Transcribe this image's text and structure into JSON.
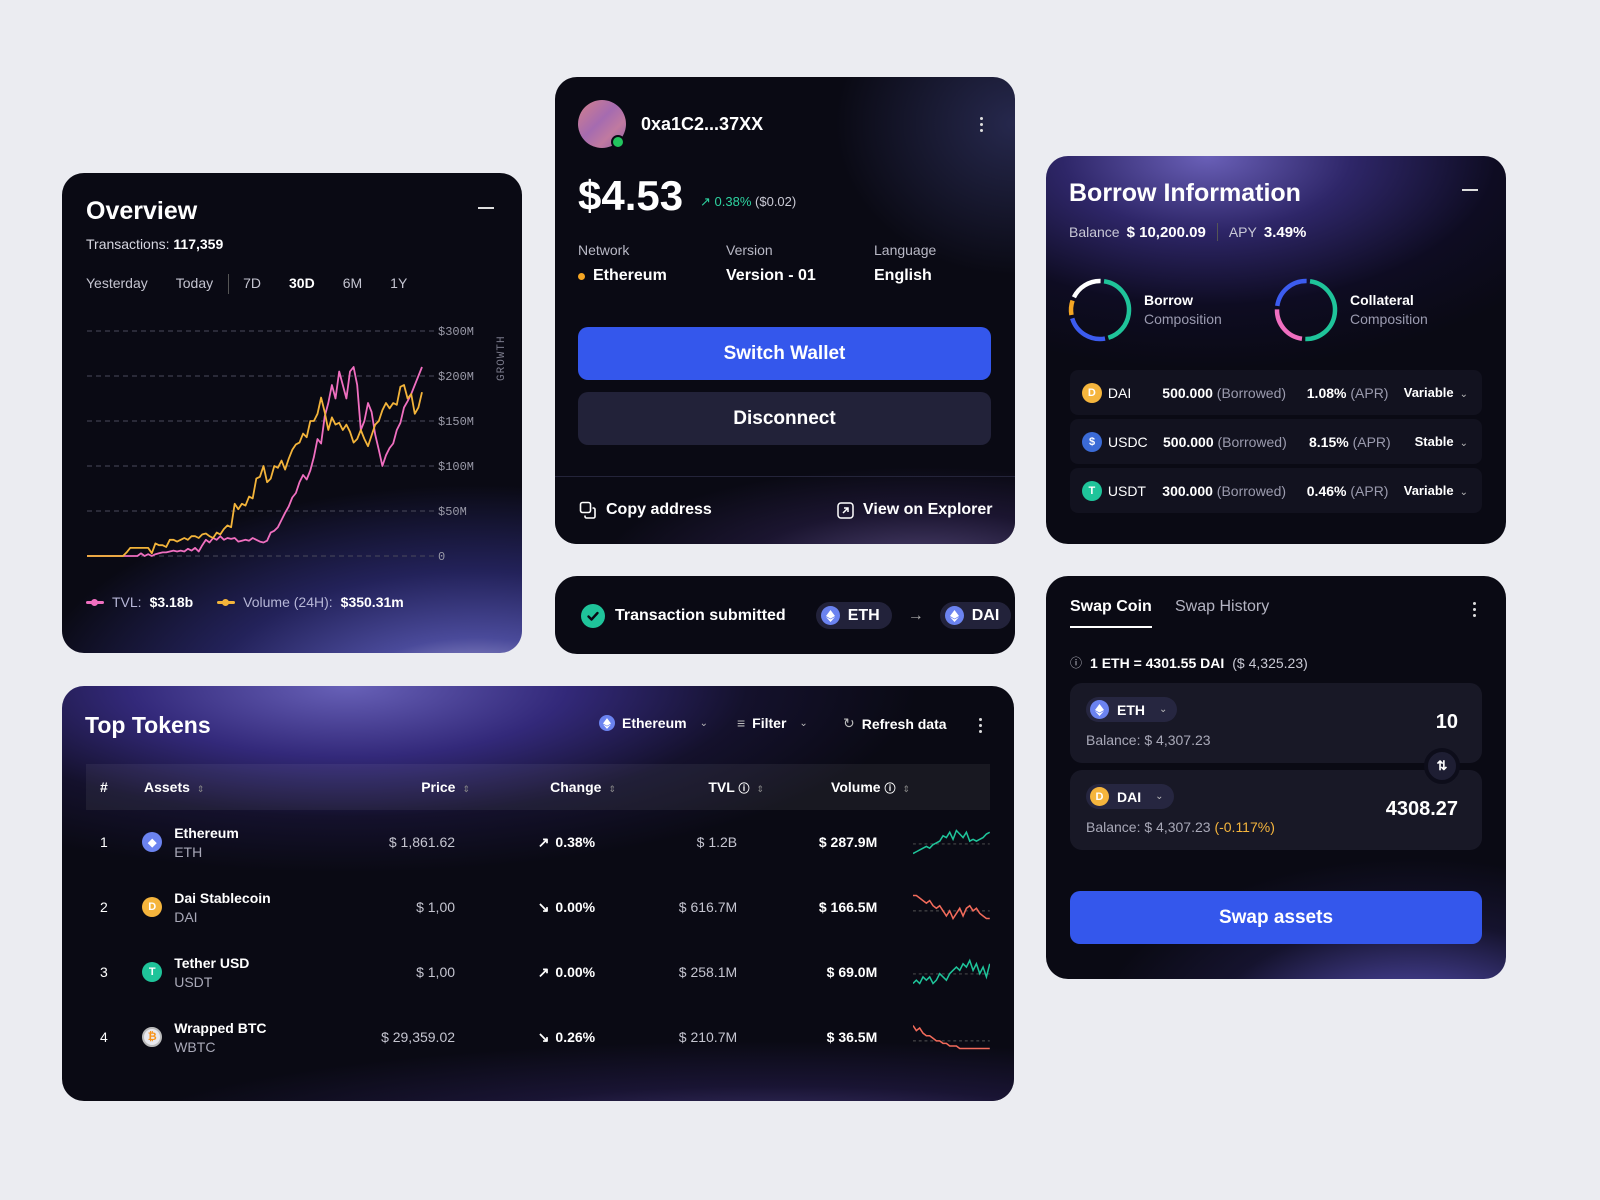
{
  "overview": {
    "title": "Overview",
    "transactions_label": "Transactions:",
    "transactions_value": "117,359",
    "ranges": [
      "Yesterday",
      "Today",
      "7D",
      "30D",
      "6M",
      "1Y"
    ],
    "active_range": "30D",
    "legend": [
      {
        "label": "TVL:",
        "value": "$3.18b",
        "color": "#f06fc0"
      },
      {
        "label": "Volume (24H):",
        "value": "$350.31m",
        "color": "#f3b43a"
      }
    ]
  },
  "chart_data": {
    "type": "line",
    "title": "",
    "xlabel": "",
    "ylabel": "GROWTH",
    "ylim": [
      0,
      300
    ],
    "y_ticks": [
      "0",
      "$50M",
      "$100M",
      "$150M",
      "$200M",
      "$300M"
    ],
    "y_tick_values": [
      0,
      50,
      100,
      150,
      200,
      250
    ],
    "grid": true,
    "legend_position": "bottom-left",
    "series": [
      {
        "name": "TVL",
        "color": "#f06fc0",
        "values": [
          0,
          0,
          0,
          0,
          0,
          0,
          0,
          0,
          0,
          0,
          0,
          0,
          0,
          0,
          0,
          3,
          0,
          2,
          0,
          2,
          3,
          4,
          4,
          5,
          6,
          5,
          6,
          5,
          8,
          6,
          9,
          5,
          12,
          18,
          15,
          20,
          18,
          22,
          18,
          20,
          19,
          20,
          16,
          17,
          18,
          17,
          20,
          18,
          16,
          15,
          17,
          26,
          28,
          32,
          40,
          48,
          55,
          65,
          70,
          82,
          90,
          85,
          95,
          110,
          130,
          125,
          155,
          170,
          190,
          175,
          205,
          190,
          175,
          205,
          210,
          190,
          140,
          150,
          170,
          160,
          135,
          118,
          100,
          112,
          120,
          125,
          140,
          148,
          165,
          172,
          180,
          190,
          200,
          210
        ]
      },
      {
        "name": "Volume (24H)",
        "color": "#f3b43a",
        "values": [
          0,
          0,
          0,
          0,
          0,
          0,
          0,
          0,
          0,
          0,
          0,
          4,
          9,
          9,
          9,
          9,
          9,
          9,
          3,
          14,
          12,
          12,
          10,
          18,
          18,
          16,
          18,
          20,
          18,
          22,
          22,
          20,
          24,
          25,
          22,
          20,
          26,
          24,
          30,
          34,
          32,
          58,
          52,
          58,
          56,
          66,
          64,
          86,
          88,
          100,
          82,
          86,
          100,
          98,
          106,
          96,
          108,
          118,
          124,
          126,
          136,
          132,
          150,
          150,
          158,
          176,
          160,
          140,
          154,
          146,
          148,
          140,
          146,
          138,
          126,
          130,
          140,
          130,
          122,
          134,
          146,
          150,
          162,
          170,
          164,
          170,
          168,
          188,
          190,
          175,
          180,
          158,
          165,
          182
        ]
      }
    ]
  },
  "wallet": {
    "address": "0xa1C2...37XX",
    "balance": "$4.53",
    "change_pct": "0.38%",
    "change_usd": "($0.02)",
    "network_label": "Network",
    "network_value": "Ethereum",
    "version_label": "Version",
    "version_value": "Version - 01",
    "language_label": "Language",
    "language_value": "English",
    "switch_label": "Switch Wallet",
    "disconnect_label": "Disconnect",
    "copy_label": "Copy address",
    "explorer_label": "View on Explorer"
  },
  "transaction": {
    "status": "Transaction submitted",
    "from": "ETH",
    "to": "DAI"
  },
  "borrow": {
    "title": "Borrow Information",
    "balance_label": "Balance",
    "balance_value": "$ 10,200.09",
    "apy_label": "APY",
    "apy_value": "3.49%",
    "borrow_comp": {
      "title": "Borrow",
      "sub": "Composition",
      "segments": [
        {
          "color": "#1fc49a",
          "share": 0.45
        },
        {
          "color": "#3c5cf0",
          "share": 0.25
        },
        {
          "color": "#f5a623",
          "share": 0.1
        },
        {
          "color": "#ffffff",
          "share": 0.2
        }
      ]
    },
    "collateral_comp": {
      "title": "Collateral",
      "sub": "Composition",
      "segments": [
        {
          "color": "#1fc49a",
          "share": 0.5
        },
        {
          "color": "#f06fc0",
          "share": 0.25
        },
        {
          "color": "#3c5cf0",
          "share": 0.25
        }
      ]
    },
    "rows": [
      {
        "symbol": "DAI",
        "amount": "500.000",
        "amount_note": "(Borrowed)",
        "apr": "1.08%",
        "apr_note": "(APR)",
        "type": "Variable",
        "color": "#f5b53d",
        "glyph": "D"
      },
      {
        "symbol": "USDC",
        "amount": "500.000",
        "amount_note": "(Borrowed)",
        "apr": "8.15%",
        "apr_note": "(APR)",
        "type": "Stable",
        "color": "#3b6bd6",
        "glyph": "$"
      },
      {
        "symbol": "USDT",
        "amount": "300.000",
        "amount_note": "(Borrowed)",
        "apr": "0.46%",
        "apr_note": "(APR)",
        "type": "Variable",
        "color": "#1fc49a",
        "glyph": "T"
      }
    ]
  },
  "tokens": {
    "title": "Top Tokens",
    "network": "Ethereum",
    "filter": "Filter",
    "refresh": "Refresh data",
    "columns": [
      "#",
      "Assets",
      "Price",
      "Change",
      "TVL",
      "Volume"
    ],
    "rows": [
      {
        "rank": "1",
        "name": "Ethereum",
        "symbol": "ETH",
        "price": "$ 1,861.62",
        "change": "0.38%",
        "trend": "up",
        "tvl": "$ 1.2B",
        "volume": "$ 287.9M",
        "color": "#6b83f0",
        "glyph": "◆",
        "spark": [
          2,
          3,
          4,
          5,
          6,
          5,
          7,
          8,
          9,
          12,
          11,
          14,
          10,
          15,
          13,
          11,
          14,
          9,
          10,
          9,
          10,
          11,
          13,
          14
        ]
      },
      {
        "rank": "2",
        "name": "Dai Stablecoin",
        "symbol": "DAI",
        "price": "$ 1,00",
        "change": "0.00%",
        "trend": "down",
        "tvl": "$ 616.7M",
        "volume": "$ 166.5M",
        "color": "#f5b53d",
        "glyph": "D",
        "spark": [
          14,
          14,
          13,
          12,
          11,
          12,
          10,
          9,
          10,
          8,
          6,
          8,
          5,
          7,
          9,
          6,
          9,
          10,
          8,
          9,
          7,
          6,
          5,
          5
        ]
      },
      {
        "rank": "3",
        "name": "Tether USD",
        "symbol": "USDT",
        "price": "$ 1,00",
        "change": "0.00%",
        "trend": "up",
        "tvl": "$ 258.1M",
        "volume": "$ 69.0M",
        "color": "#1fc49a",
        "glyph": "T",
        "spark": [
          6,
          7,
          6,
          8,
          7,
          8,
          6,
          7,
          9,
          8,
          7,
          9,
          10,
          11,
          10,
          12,
          11,
          13,
          10,
          12,
          9,
          11,
          8,
          12
        ]
      },
      {
        "rank": "4",
        "name": "Wrapped BTC",
        "symbol": "WBTC",
        "price": "$ 29,359.02",
        "change": "0.26%",
        "trend": "down",
        "tvl": "$ 210.7M",
        "volume": "$ 36.5M",
        "color": "#e8e8ee",
        "glyph": "₿",
        "spark": [
          14,
          12,
          13,
          11,
          10,
          10,
          9,
          8,
          8,
          7,
          7,
          6,
          6,
          6,
          5,
          5,
          5,
          5,
          5,
          5,
          5,
          5,
          5,
          5
        ]
      }
    ]
  },
  "swap": {
    "tab_active": "Swap Coin",
    "tab_inactive": "Swap History",
    "rate": "1 ETH = 4301.55 DAI",
    "rate_usd": "($ 4,325.23)",
    "from_token": "ETH",
    "from_balance": "Balance: $ 4,307.23",
    "from_amount": "10",
    "to_token": "DAI",
    "to_balance": "Balance: $ 4,307.23",
    "to_change": "(-0.117%)",
    "to_amount": "4308.27",
    "button": "Swap assets"
  }
}
